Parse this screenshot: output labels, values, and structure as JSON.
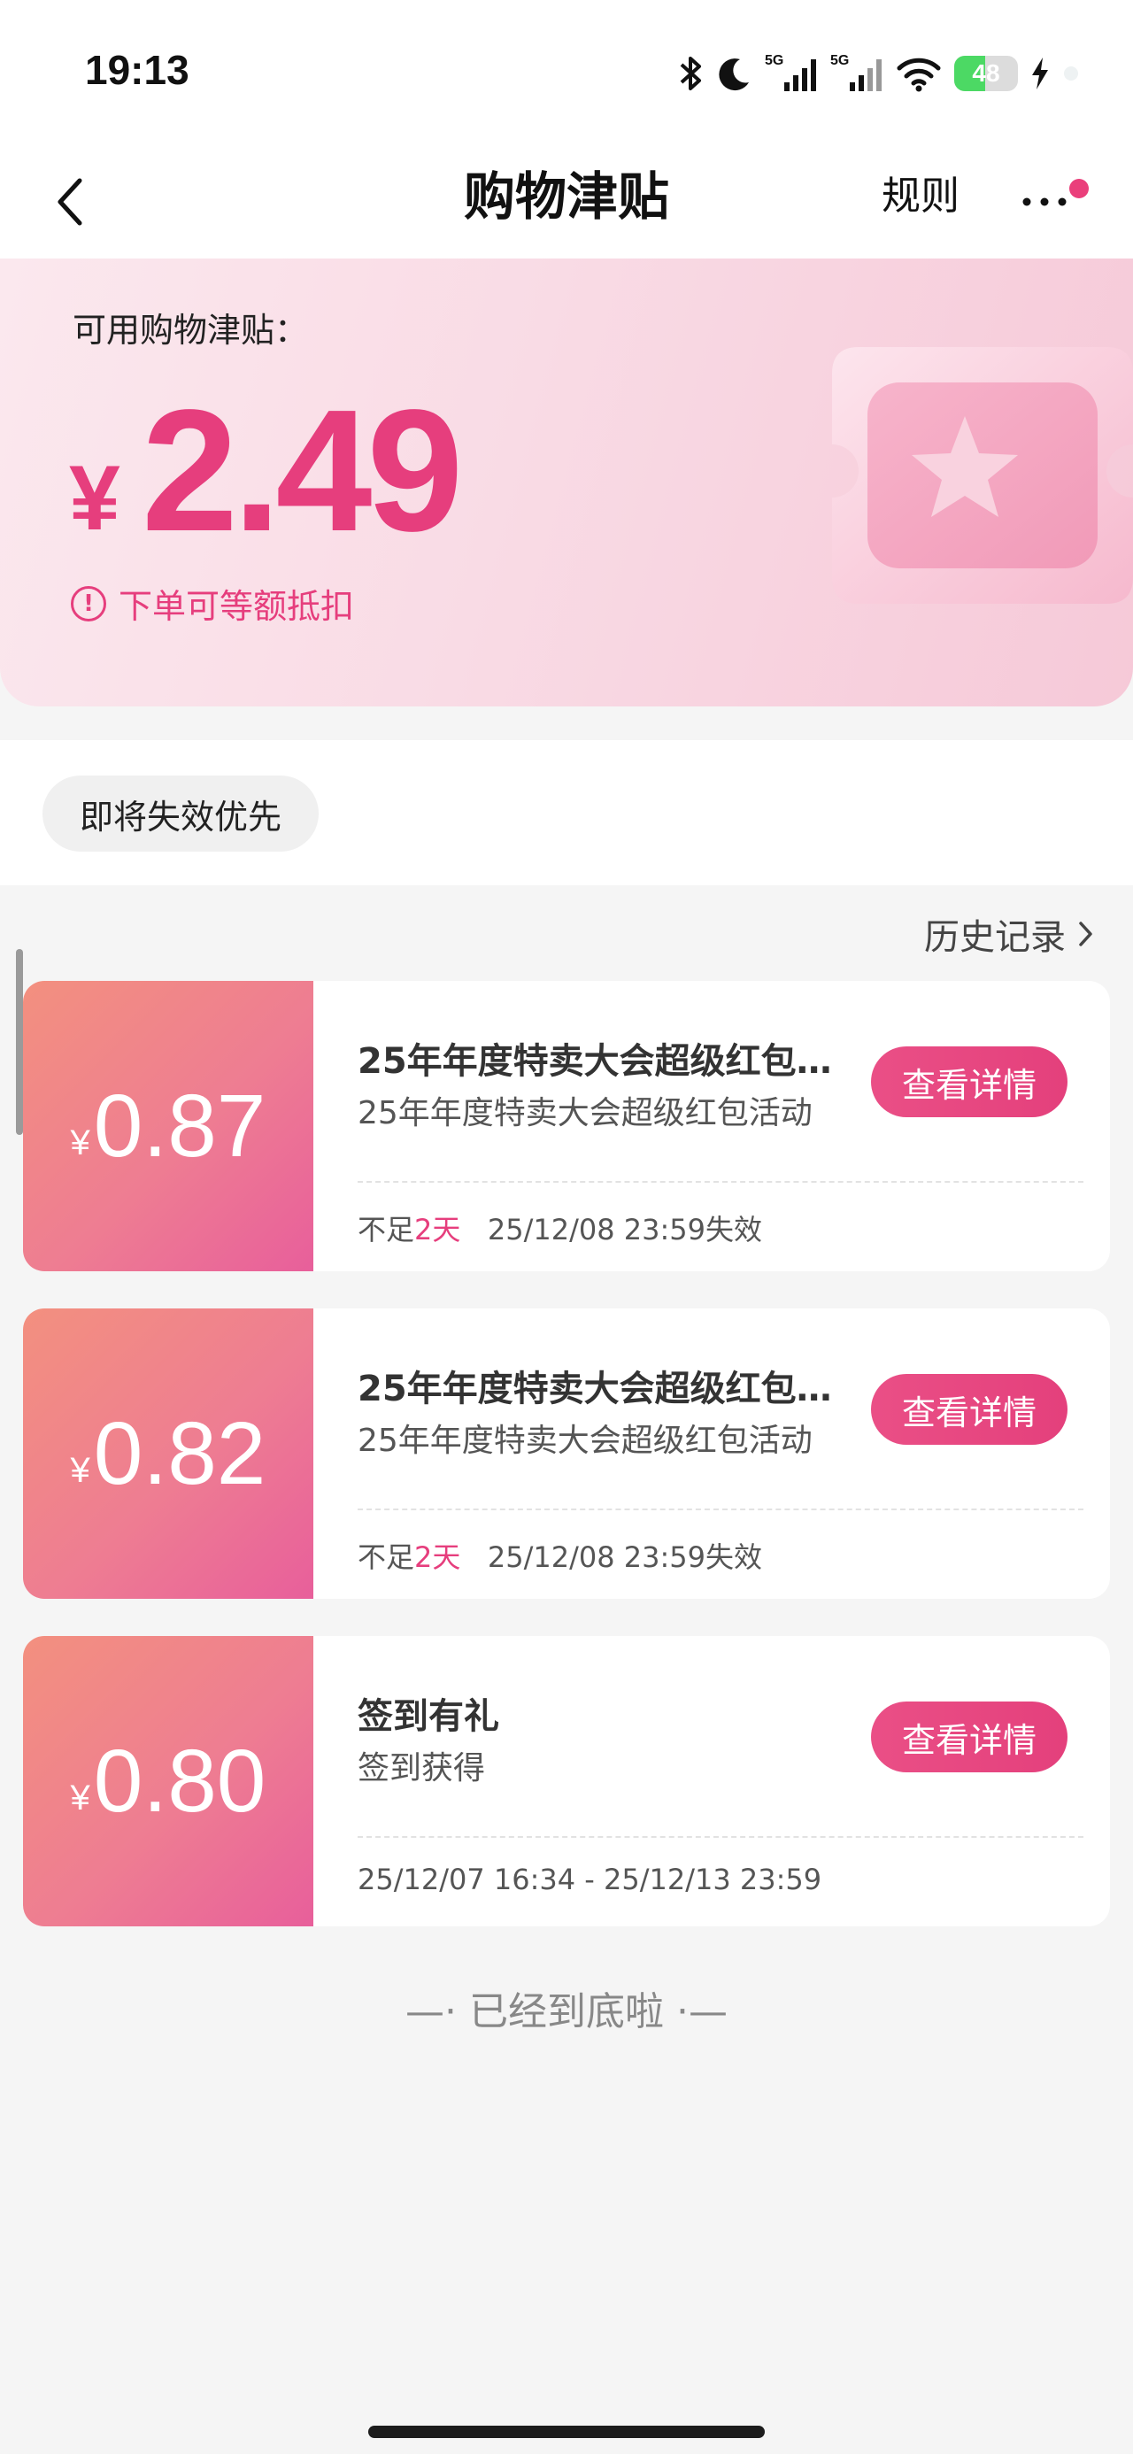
{
  "status_bar": {
    "time": "19:13",
    "icons": [
      "bluetooth-icon",
      "moon-icon",
      "signal-5g-icon",
      "signal-5g-icon",
      "wifi-icon",
      "battery-icon",
      "charging-icon"
    ],
    "network_label_1": "5G",
    "network_label_2": "5G",
    "battery_level": "48",
    "battery_fraction": 0.48
  },
  "nav": {
    "title": "购物津贴",
    "rules_label": "规则",
    "notification_dot_color": "#e63e7d"
  },
  "hero": {
    "label": "可用购物津贴：",
    "currency": "¥",
    "amount": "2.49",
    "note": "下单可等额抵扣",
    "accent_color": "#e63e7d"
  },
  "filter": {
    "chip_label": "即将失效优先"
  },
  "history": {
    "label": "历史记录"
  },
  "cards": [
    {
      "currency": "¥",
      "amount": "0.87",
      "title": "25年年度特卖大会超级红包...",
      "subtitle": "25年年度特卖大会超级红包活动",
      "button": "查看详情",
      "expiry_prefix": "不足",
      "expiry_days": "2天",
      "expiry_date": "25/12/08 23:59失效"
    },
    {
      "currency": "¥",
      "amount": "0.82",
      "title": "25年年度特卖大会超级红包...",
      "subtitle": "25年年度特卖大会超级红包活动",
      "button": "查看详情",
      "expiry_prefix": "不足",
      "expiry_days": "2天",
      "expiry_date": "25/12/08 23:59失效"
    },
    {
      "currency": "¥",
      "amount": "0.80",
      "title": "签到有礼",
      "subtitle": "签到获得",
      "button": "查看详情",
      "validity": "25/12/07 16:34 - 25/12/13 23:59"
    }
  ],
  "footer": {
    "end_text": "—· 已经到底啦 ·—"
  }
}
